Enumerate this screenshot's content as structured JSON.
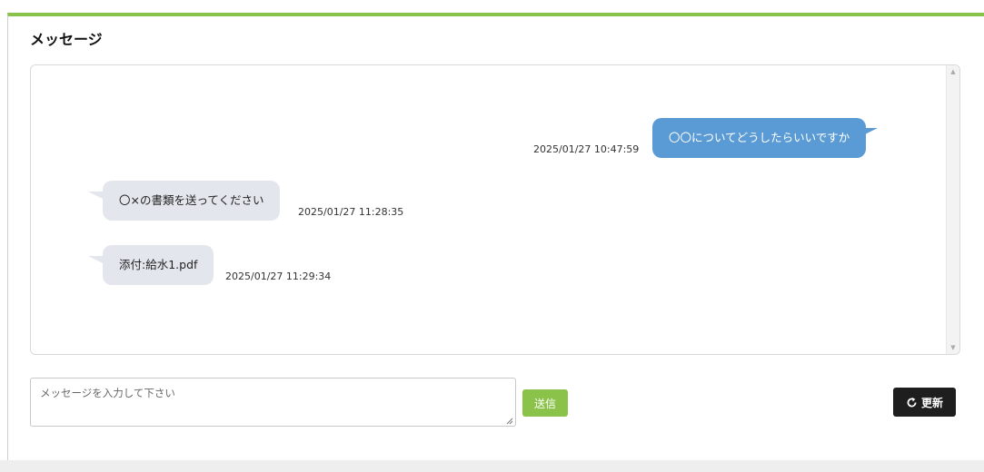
{
  "panel": {
    "title": "メッセージ"
  },
  "messages": [
    {
      "direction": "sent",
      "text": "〇〇についてどうしたらいいですか",
      "timestamp": "2025/01/27 10:47:59"
    },
    {
      "direction": "received",
      "text": "〇×の書類を送ってください",
      "timestamp": "2025/01/27 11:28:35"
    },
    {
      "direction": "received",
      "text": "添付:給水1.pdf",
      "timestamp": "2025/01/27 11:29:34"
    }
  ],
  "composer": {
    "placeholder": "メッセージを入力して下さい",
    "value": "",
    "send_label": "送信"
  },
  "toolbar": {
    "refresh_label": "更新",
    "refresh_icon": "refresh-icon"
  },
  "colors": {
    "accent_green": "#8bc34a",
    "sent_bubble": "#5b9bd5",
    "received_bubble": "#e3e6ec",
    "refresh_button": "#1e1e1e"
  }
}
